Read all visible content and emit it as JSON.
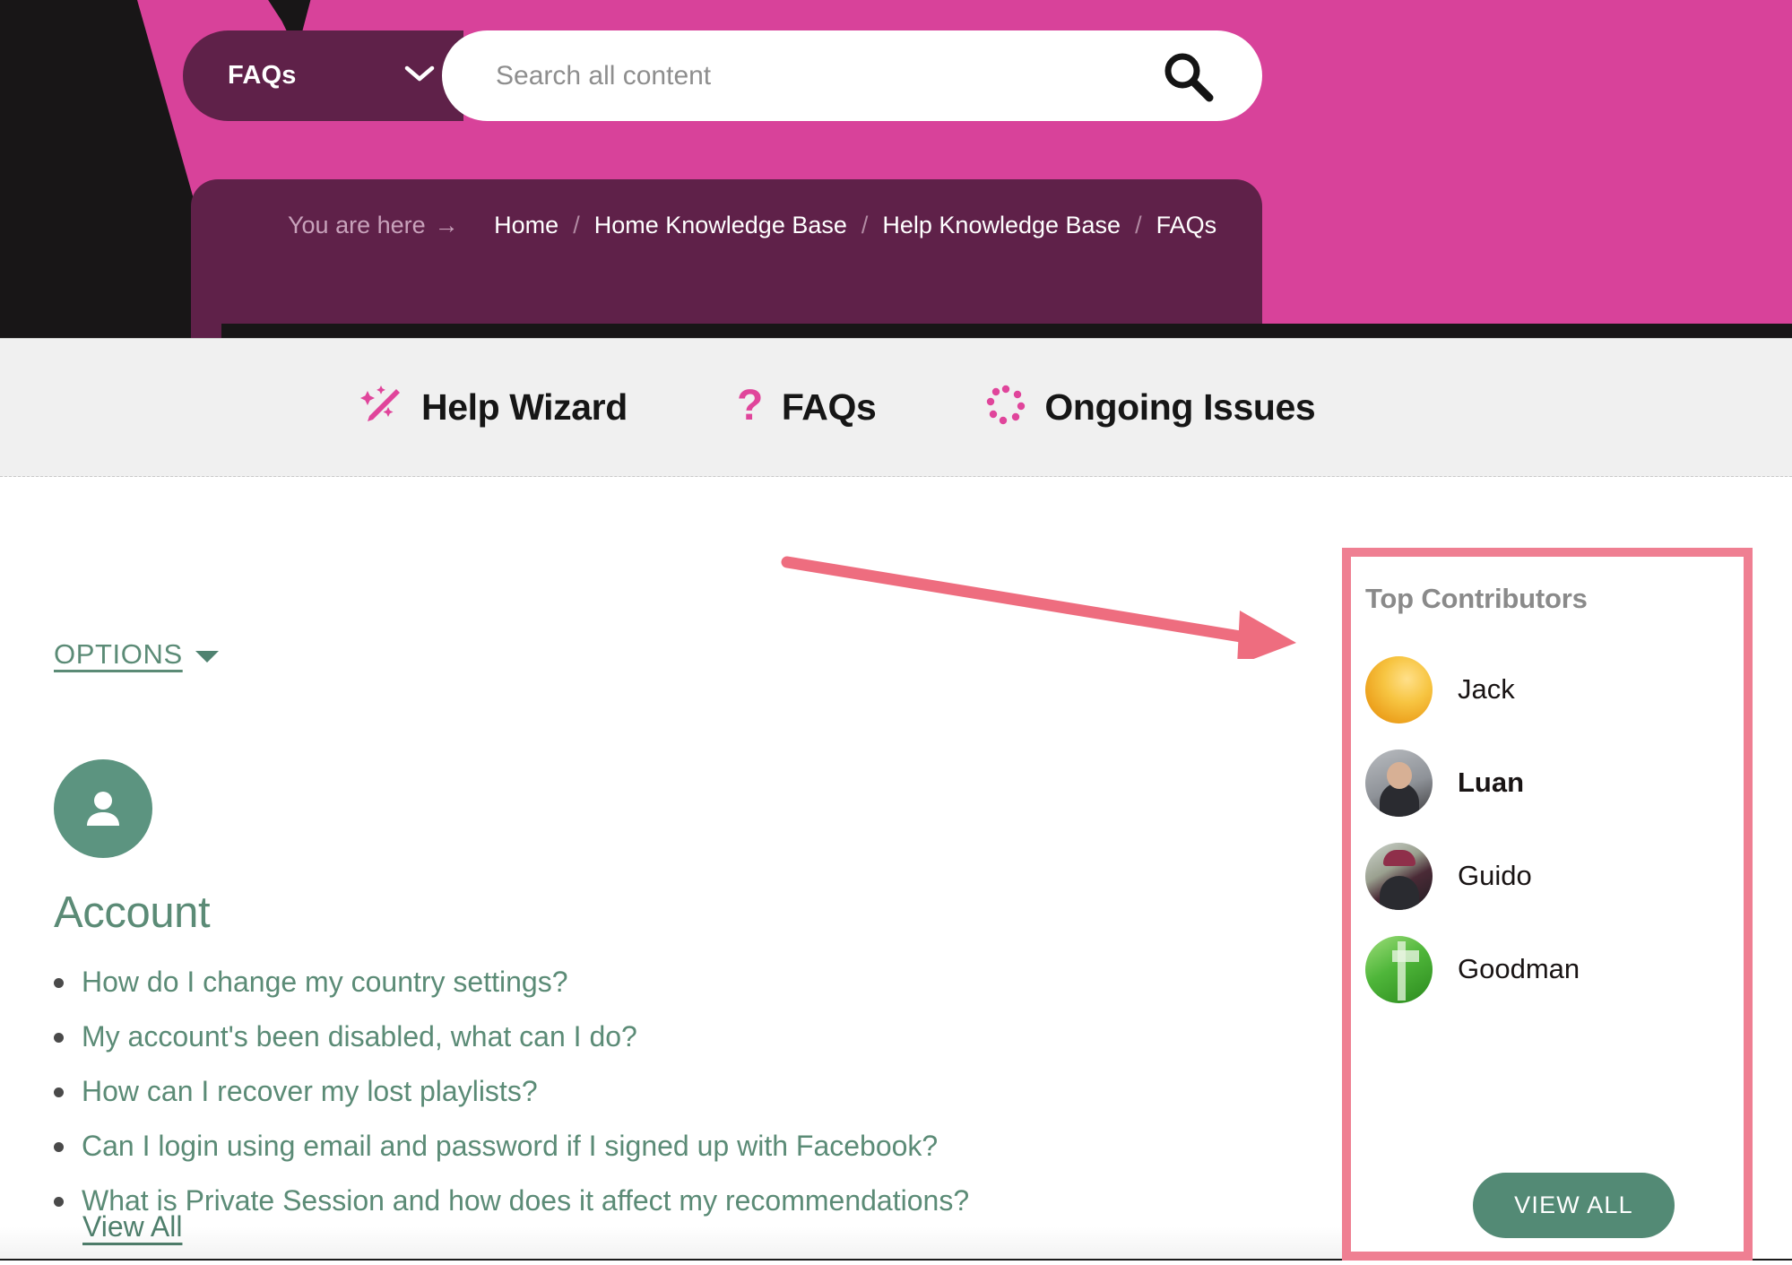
{
  "header": {
    "scope_selector": {
      "label": "FAQs",
      "icon": "chevron-down-icon"
    },
    "search": {
      "placeholder": "Search all content",
      "value": "",
      "icon": "search-icon"
    }
  },
  "breadcrumb": {
    "prefix": "You are here",
    "arrow": "→",
    "separator": "/",
    "items": [
      "Home",
      "Home Knowledge Base",
      "Help Knowledge Base",
      "FAQs"
    ]
  },
  "nav": {
    "items": [
      {
        "label": "Help Wizard",
        "icon": "magic-wand-icon"
      },
      {
        "label": "FAQs",
        "icon": "question-mark-icon"
      },
      {
        "label": "Ongoing Issues",
        "icon": "spinner-dots-icon"
      }
    ]
  },
  "main": {
    "options": {
      "label": "OPTIONS",
      "icon": "caret-down-icon"
    },
    "category": {
      "icon": "person-avatar-icon",
      "title": "Account",
      "faqs": [
        "How do I change my country settings?",
        "My account's been disabled, what can I do?",
        "How can I recover my lost playlists?",
        "Can I login using email and password if I signed up with Facebook?",
        "What is Private Session and how does it affect my recommendations?"
      ],
      "view_all": "View All"
    }
  },
  "contributors": {
    "title": "Top Contributors",
    "people": [
      {
        "name": "Jack",
        "bold": false,
        "avatar": "avatar-jack"
      },
      {
        "name": "Luan",
        "bold": true,
        "avatar": "avatar-luan"
      },
      {
        "name": "Guido",
        "bold": false,
        "avatar": "avatar-guido"
      },
      {
        "name": "Goodman",
        "bold": false,
        "avatar": "avatar-goodman"
      }
    ],
    "view_all_button": "VIEW ALL"
  },
  "colors": {
    "brand_pink": "#d8429a",
    "deep_plum": "#5f2149",
    "accent_green": "#5b8b76",
    "button_green": "#538a75",
    "highlight_pink": "#ef7f92",
    "nav_band": "#f0f0f0"
  }
}
